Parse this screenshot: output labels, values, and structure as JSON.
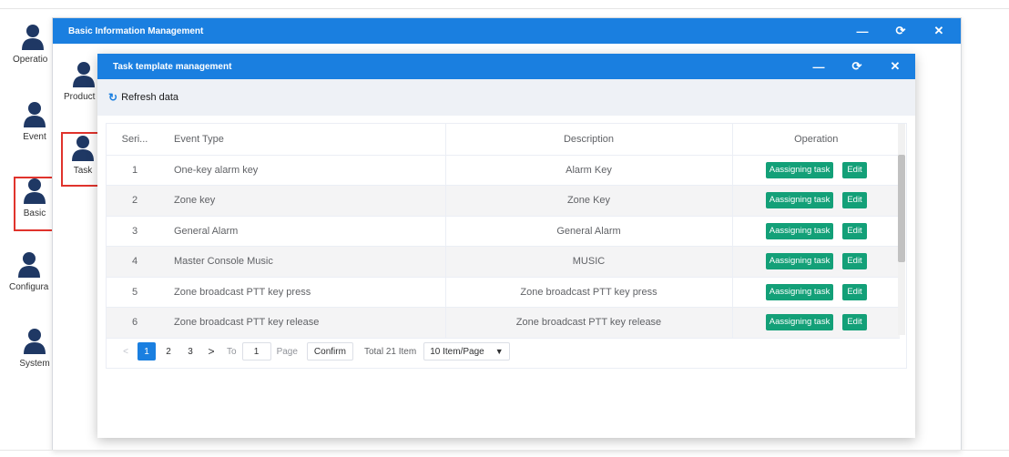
{
  "desktop_icons": [
    {
      "label": "Operatio"
    },
    {
      "label": "Event"
    },
    {
      "label": "Basic"
    },
    {
      "label": "Configura"
    },
    {
      "label": "System"
    }
  ],
  "sub_icons": [
    {
      "label": "Product"
    },
    {
      "label": "Task"
    }
  ],
  "outer_window": {
    "title": "Basic Information Management"
  },
  "inner_window": {
    "title": "Task template management"
  },
  "window_controls": {
    "minimize": "—",
    "restore": "⟳",
    "close": "✕"
  },
  "toolbar": {
    "refresh_label": "Refresh data",
    "refresh_icon": "refresh-icon"
  },
  "table": {
    "headers": {
      "serial": "Seri...",
      "event_type": "Event Type",
      "description": "Description",
      "operation": "Operation"
    },
    "assign_label": "Aassigning task",
    "edit_label": "Edit",
    "rows": [
      {
        "serial": "1",
        "event_type": "One-key alarm key",
        "description": "Alarm Key"
      },
      {
        "serial": "2",
        "event_type": "Zone key",
        "description": "Zone Key"
      },
      {
        "serial": "3",
        "event_type": "General Alarm",
        "description": "General Alarm"
      },
      {
        "serial": "4",
        "event_type": "Master Console Music",
        "description": "MUSIC"
      },
      {
        "serial": "5",
        "event_type": "Zone broadcast PTT key press",
        "description": "Zone broadcast PTT key press"
      },
      {
        "serial": "6",
        "event_type": "Zone broadcast PTT key release",
        "description": "Zone broadcast PTT key release"
      }
    ]
  },
  "pagination": {
    "prev": "<",
    "pages": [
      "1",
      "2",
      "3"
    ],
    "current_page": "1",
    "next": ">",
    "to_label": "To",
    "goto_value": "1",
    "page_label": "Page",
    "confirm_label": "Confirm",
    "total_label": "Total 21 Item",
    "page_size": "10 Item/Page"
  },
  "colors": {
    "title_bar": "#1a7fe0",
    "action_button": "#13a078",
    "highlight_box": "#e0332c"
  }
}
